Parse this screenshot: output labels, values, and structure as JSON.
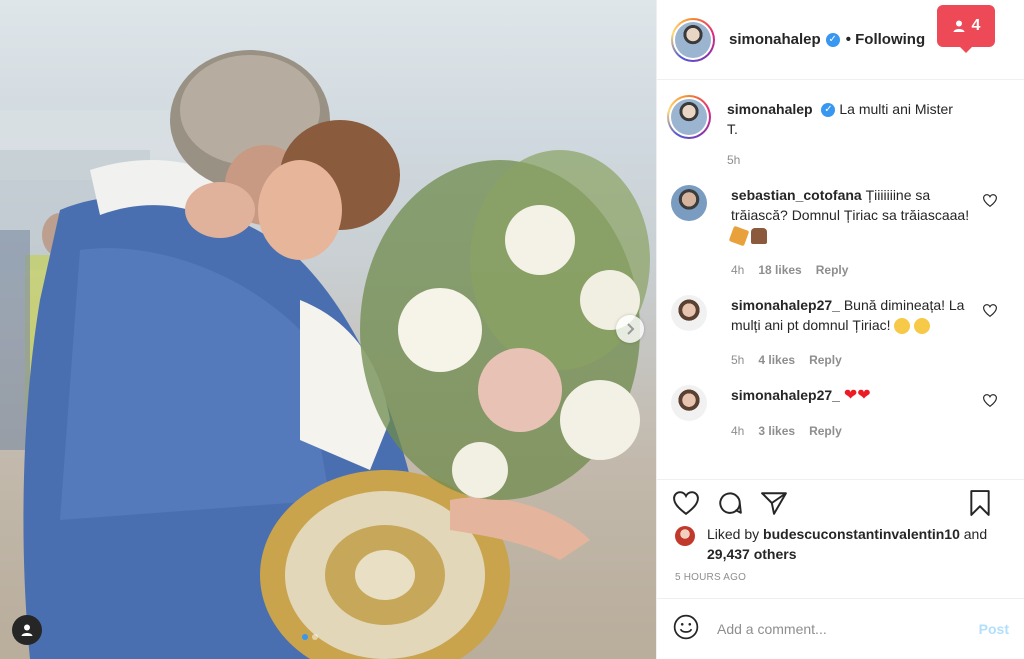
{
  "post": {
    "author": "simonahalep",
    "follow_status": "• Following",
    "notification_count": "4",
    "caption_user": "simonahalep",
    "caption_text": "La multi ani Mister T.",
    "caption_time": "5h"
  },
  "comments": [
    {
      "user": "sebastian_cotofana",
      "text": "Țiiiiiiine sa trăiască? Domnul Țiriac sa trăiascaaa!",
      "emojis": [
        "party-popper-emoji",
        "cake-emoji"
      ],
      "time": "4h",
      "likes": "18 likes",
      "reply": "Reply"
    },
    {
      "user": "simonahalep27_",
      "text": "Bună dimineața! La mulți ani pt domnul Țiriac!",
      "emojis": [
        "hugging-emoji",
        "hugging-emoji"
      ],
      "time": "5h",
      "likes": "4 likes",
      "reply": "Reply"
    },
    {
      "user": "simonahalep27_",
      "text": "",
      "emojis": [
        "red-heart-emoji",
        "red-heart-emoji"
      ],
      "time": "4h",
      "likes": "3 likes",
      "reply": "Reply"
    }
  ],
  "likes": {
    "prefix": "Liked by ",
    "user": "budescuconstantinvalentin10",
    "and": " and",
    "others": "29,437 others"
  },
  "timestamp": "5 HOURS AGO",
  "composer": {
    "placeholder": "Add a comment...",
    "post_label": "Post"
  },
  "colors": {
    "accent": "#3897f0",
    "badge": "#ed4956",
    "post_disabled": "#b2dffc",
    "muted": "#8e8e8e"
  }
}
